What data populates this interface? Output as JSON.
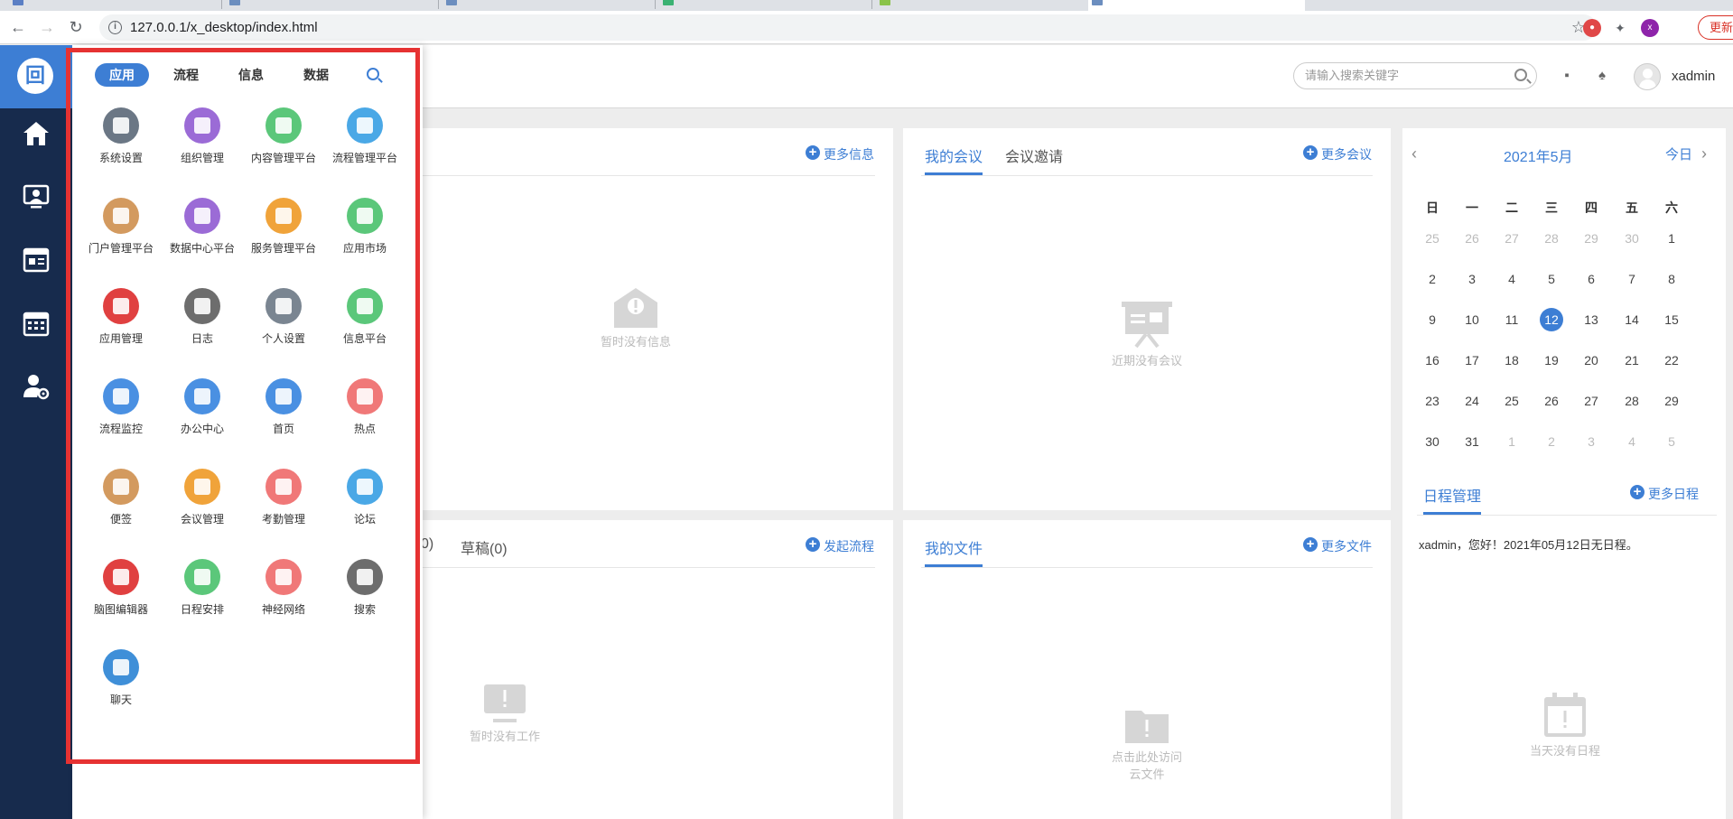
{
  "browser": {
    "url": "127.0.0.1/x_desktop/index.html",
    "update_label": "更新",
    "profile_initial": "x"
  },
  "header": {
    "search_placeholder": "请输入搜索关键字",
    "username": "xadmin"
  },
  "launcher": {
    "tabs": [
      "应用",
      "流程",
      "信息",
      "数据"
    ],
    "active_tab": "应用",
    "apps": [
      {
        "label": "系统设置",
        "color": "#6b7785",
        "icon": "gear-icon"
      },
      {
        "label": "组织管理",
        "color": "#9b6bd6",
        "icon": "org-chart-icon"
      },
      {
        "label": "内容管理平台",
        "color": "#5bc77a",
        "icon": "monitor-icon"
      },
      {
        "label": "流程管理平台",
        "color": "#4aa8e6",
        "icon": "flow-icon"
      },
      {
        "label": "门户管理平台",
        "color": "#d39a5f",
        "icon": "portal-icon"
      },
      {
        "label": "数据中心平台",
        "color": "#9b6bd6",
        "icon": "chart-board-icon"
      },
      {
        "label": "服务管理平台",
        "color": "#f0a33a",
        "icon": "service-icon"
      },
      {
        "label": "应用市场",
        "color": "#5bc77a",
        "icon": "shopping-bag-icon"
      },
      {
        "label": "应用管理",
        "color": "#e04040",
        "icon": "app-manage-icon"
      },
      {
        "label": "日志",
        "color": "#6d6d6d",
        "icon": "log-icon"
      },
      {
        "label": "个人设置",
        "color": "#7a8591",
        "icon": "user-settings-icon"
      },
      {
        "label": "信息平台",
        "color": "#5bc77a",
        "icon": "news-icon"
      },
      {
        "label": "流程监控",
        "color": "#4a90e2",
        "icon": "gauge-icon"
      },
      {
        "label": "办公中心",
        "color": "#4a90e2",
        "icon": "office-icon"
      },
      {
        "label": "首页",
        "color": "#4a90e2",
        "icon": "home-icon"
      },
      {
        "label": "热点",
        "color": "#f07878",
        "icon": "flame-icon"
      },
      {
        "label": "便签",
        "color": "#d39a5f",
        "icon": "note-icon"
      },
      {
        "label": "会议管理",
        "color": "#f0a33a",
        "icon": "meeting-icon"
      },
      {
        "label": "考勤管理",
        "color": "#f07878",
        "icon": "touch-icon"
      },
      {
        "label": "论坛",
        "color": "#4aa8e6",
        "icon": "forum-icon"
      },
      {
        "label": "脑图编辑器",
        "color": "#e04040",
        "icon": "mindmap-icon"
      },
      {
        "label": "日程安排",
        "color": "#5bc77a",
        "icon": "calendar-icon"
      },
      {
        "label": "神经网络",
        "color": "#f07878",
        "icon": "brain-icon"
      },
      {
        "label": "搜索",
        "color": "#6d6d6d",
        "icon": "search-icon"
      },
      {
        "label": "聊天",
        "color": "#3f8fd8",
        "icon": "chat-icon"
      }
    ]
  },
  "info_panel": {
    "more_label": "更多信息",
    "empty_text": "暂时没有信息"
  },
  "meeting_panel": {
    "tabs": [
      "我的会议",
      "会议邀请"
    ],
    "more_label": "更多会议",
    "empty_text": "近期没有会议"
  },
  "work_panel": {
    "tabs": [
      "0)",
      "草稿(0)"
    ],
    "more_label": "发起流程",
    "empty_text": "暂时没有工作"
  },
  "file_panel": {
    "tabs": [
      "我的文件"
    ],
    "more_label": "更多文件",
    "empty_line1": "点击此处访问",
    "empty_line2": "云文件"
  },
  "calendar": {
    "month_label": "2021年5月",
    "today_label": "今日",
    "weekdays": [
      "日",
      "一",
      "二",
      "三",
      "四",
      "五",
      "六"
    ],
    "weeks": [
      [
        "25",
        "26",
        "27",
        "28",
        "29",
        "30",
        "1"
      ],
      [
        "2",
        "3",
        "4",
        "5",
        "6",
        "7",
        "8"
      ],
      [
        "9",
        "10",
        "11",
        "12",
        "13",
        "14",
        "15"
      ],
      [
        "16",
        "17",
        "18",
        "19",
        "20",
        "21",
        "22"
      ],
      [
        "23",
        "24",
        "25",
        "26",
        "27",
        "28",
        "29"
      ],
      [
        "30",
        "31",
        "1",
        "2",
        "3",
        "4",
        "5"
      ]
    ],
    "today": "12",
    "schedule_title": "日程管理",
    "schedule_more": "更多日程",
    "schedule_message": "xadmin，您好！2021年05月12日无日程。",
    "schedule_empty": "当天没有日程"
  }
}
